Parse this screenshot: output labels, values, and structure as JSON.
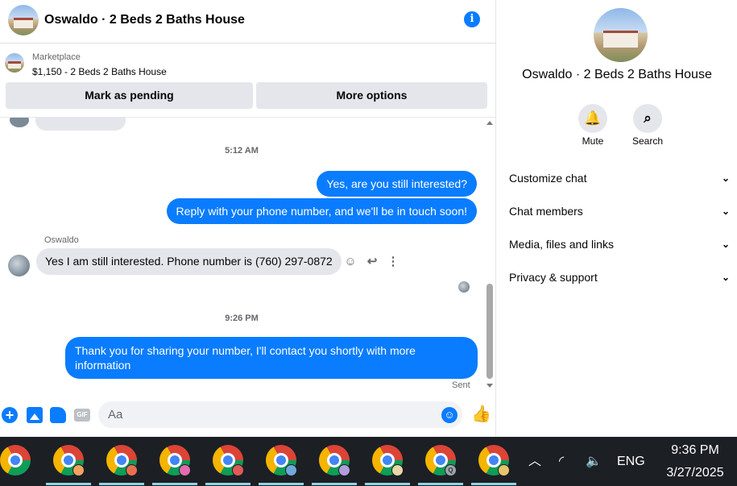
{
  "header": {
    "title": "Oswaldo · 2 Beds 2 Baths House",
    "info_icon": "info-icon"
  },
  "listing": {
    "category": "Marketplace",
    "description": "$1,150 - 2 Beds 2 Baths House"
  },
  "actions": {
    "pending_label": "Mark as pending",
    "more_label": "More options"
  },
  "messages": {
    "time1": "5:12 AM",
    "out1": "Yes, are you still interested?",
    "out2": "Reply with your phone number, and we'll be in touch soon!",
    "sender_name": "Oswaldo",
    "in1": "Yes I am still interested. Phone number is (760) 297-0872",
    "time2": "9:26 PM",
    "out3": "Thank you for sharing your number, I'll contact you shortly with more information",
    "status": "Sent"
  },
  "composer": {
    "placeholder": "Aa",
    "icons": [
      "plus-icon",
      "image-icon",
      "sticker-icon",
      "gif-icon",
      "emoji-icon",
      "like-icon"
    ],
    "gif_label": "GIF"
  },
  "side": {
    "title": "Oswaldo · 2 Beds 2 Baths House",
    "mute_label": "Mute",
    "search_label": "Search",
    "sections": [
      "Customize chat",
      "Chat members",
      "Media, files and links",
      "Privacy & support"
    ]
  },
  "taskbar": {
    "apps": [
      {
        "name": "chrome",
        "badge": ""
      },
      {
        "name": "chrome-profile",
        "badge": "",
        "badge_color": "#f4a261"
      },
      {
        "name": "chrome-profile",
        "badge": "",
        "badge_color": "#e76f51"
      },
      {
        "name": "chrome-profile",
        "badge": "",
        "badge_color": "#e56bb0"
      },
      {
        "name": "chrome-profile",
        "badge": "",
        "badge_color": "#e05a5a"
      },
      {
        "name": "chrome-profile",
        "badge": "",
        "badge_color": "#6fa8dc"
      },
      {
        "name": "chrome-profile",
        "badge": "",
        "badge_color": "#b39ddb"
      },
      {
        "name": "chrome-profile",
        "badge": "",
        "badge_color": "#e9d8a6"
      },
      {
        "name": "chrome-profile",
        "badge": "Q",
        "badge_color": "#9aa5ad"
      },
      {
        "name": "chrome-profile",
        "badge": "",
        "badge_color": "#e9c46a"
      }
    ],
    "language": "ENG",
    "time": "9:36 PM",
    "date": "3/27/2025"
  },
  "colors": {
    "accent": "#0a7cff",
    "taskbar": "#1c1f24"
  }
}
